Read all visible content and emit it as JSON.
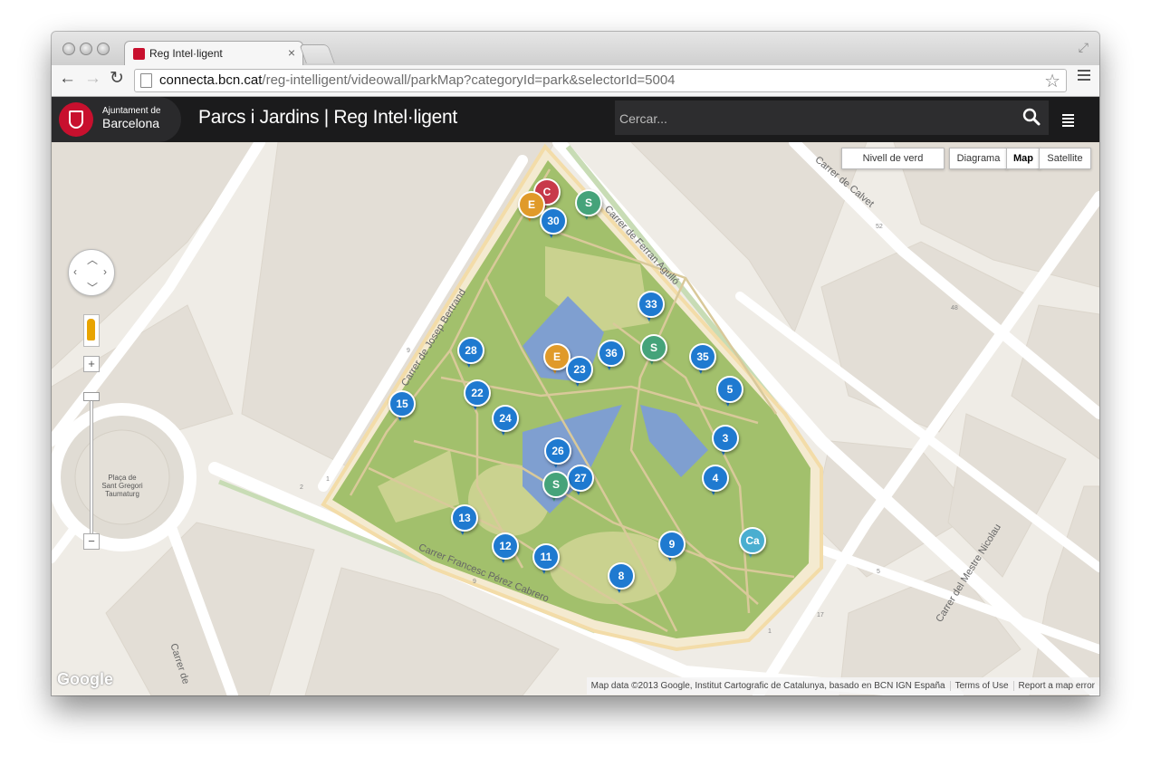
{
  "browser": {
    "tab_title": "Reg Intel·ligent",
    "tab_close": "×",
    "url_host": "connecta.bcn.cat",
    "url_path": "/reg-intelligent/videowall/parkMap?categoryId=park&selectorId=5004",
    "back": "←",
    "forward": "→",
    "reload": "↻",
    "star": "☆",
    "fullscreen": "⤢"
  },
  "app": {
    "logo_line1": "Ajuntament de",
    "logo_line2": "Barcelona",
    "title": "Parcs i Jardins | Reg Intel·ligent",
    "search_placeholder": "Cercar..."
  },
  "map": {
    "layer_button": "Nivell de verd",
    "map_types": [
      "Diagrama",
      "Map",
      "Satellite"
    ],
    "selected_map_type": "Map",
    "zoom_in": "+",
    "zoom_out": "−",
    "logo": "Google",
    "attribution": "Map data ©2013 Google, Institut Cartografic de Catalunya, basado en BCN IGN España",
    "terms": "Terms of Use",
    "report": "Report a map error",
    "streets": {
      "calvet": "Carrer de Calvet",
      "ferran": "Carrer de Ferran Agulló",
      "bertrand": "Carrer de Josep Bertrand",
      "francesc": "Carrer Francesc Pérez Cabrero",
      "mestre": "Carrer del Mestre Nicolau",
      "placa1": "Plaça de",
      "placa2": "Sant Gregori",
      "placa3": "Taumaturg",
      "carrer_de": "Carrer de"
    },
    "house_numbers": [
      "52",
      "48",
      "9",
      "2",
      "1",
      "9",
      "5",
      "17",
      "1"
    ],
    "colors": {
      "blue": "#1f7ad0",
      "red": "#c83a4a",
      "orange": "#e09a2a",
      "green": "#45a37a",
      "teal": "#4aaed0",
      "park": "#a2c06c",
      "water": "#7f9fd0"
    },
    "markers": [
      {
        "label": "C",
        "color": "red"
      },
      {
        "label": "E",
        "color": "orange"
      },
      {
        "label": "S",
        "color": "green"
      },
      {
        "label": "30",
        "color": "blue"
      },
      {
        "label": "33",
        "color": "blue"
      },
      {
        "label": "28",
        "color": "blue"
      },
      {
        "label": "36",
        "color": "blue"
      },
      {
        "label": "S",
        "color": "green"
      },
      {
        "label": "35",
        "color": "blue"
      },
      {
        "label": "E",
        "color": "orange"
      },
      {
        "label": "23",
        "color": "blue"
      },
      {
        "label": "22",
        "color": "blue"
      },
      {
        "label": "15",
        "color": "blue"
      },
      {
        "label": "5",
        "color": "blue"
      },
      {
        "label": "24",
        "color": "blue"
      },
      {
        "label": "3",
        "color": "blue"
      },
      {
        "label": "26",
        "color": "blue"
      },
      {
        "label": "27",
        "color": "blue"
      },
      {
        "label": "S",
        "color": "green"
      },
      {
        "label": "4",
        "color": "blue"
      },
      {
        "label": "13",
        "color": "blue"
      },
      {
        "label": "12",
        "color": "blue"
      },
      {
        "label": "11",
        "color": "blue"
      },
      {
        "label": "9",
        "color": "blue"
      },
      {
        "label": "Ca",
        "color": "teal"
      },
      {
        "label": "8",
        "color": "blue"
      }
    ]
  }
}
